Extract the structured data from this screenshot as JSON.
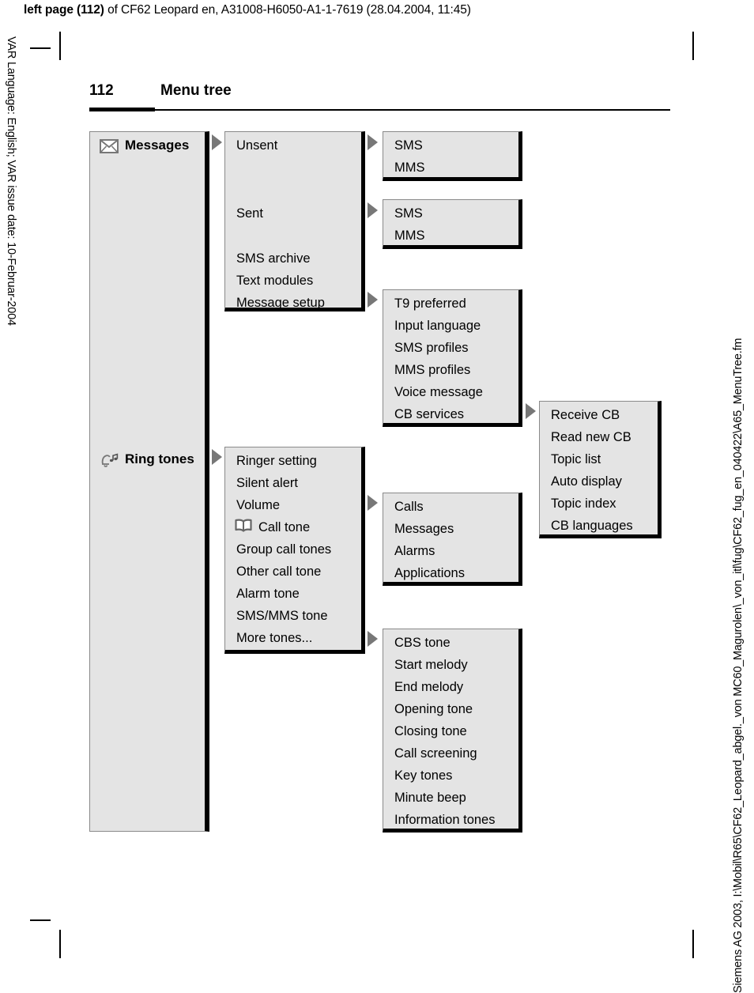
{
  "header": {
    "bold_prefix": "left page (112)",
    "rest": " of CF62 Leopard en, A31008-H6050-A1-1-7619 (28.04.2004, 11:45)"
  },
  "side_text": {
    "left": "VAR Language: English; VAR issue date: 10-Februar-2004",
    "right": "Siemens AG 2003, I:\\Mobil\\R65\\CF62_Leopard_abgel._von MC60_Magurolen\\_von_itl\\fug\\CF62_fug_en_040422\\A65_MenuTree.fm"
  },
  "running_head": {
    "page_number": "112",
    "title": "Menu tree"
  },
  "menu": {
    "messages": {
      "label": "Messages",
      "icon": "envelope-icon",
      "items": [
        {
          "label": "Unsent",
          "has_arrow": true
        },
        {
          "label": "Sent",
          "has_arrow": true
        },
        {
          "label": "SMS archive",
          "has_arrow": false
        },
        {
          "label": "Text modules",
          "has_arrow": false
        },
        {
          "label": "Message setup",
          "has_arrow": true
        }
      ],
      "unsent_sub": [
        "SMS",
        "MMS"
      ],
      "sent_sub": [
        "SMS",
        "MMS"
      ],
      "message_setup_sub": [
        {
          "label": "T9 preferred",
          "has_arrow": false
        },
        {
          "label": "Input language",
          "has_arrow": false
        },
        {
          "label": "SMS profiles",
          "has_arrow": false
        },
        {
          "label": "MMS profiles",
          "has_arrow": false
        },
        {
          "label": "Voice message",
          "has_arrow": false
        },
        {
          "label": "CB services",
          "has_arrow": true
        }
      ],
      "cb_services_sub": [
        "Receive CB",
        "Read new CB",
        "Topic list",
        "Auto display",
        "Topic index",
        "CB languages"
      ]
    },
    "ring_tones": {
      "label": "Ring tones",
      "icon": "bell-note-icon",
      "items": [
        {
          "label": "Ringer setting",
          "has_arrow": false,
          "icon": null
        },
        {
          "label": "Silent alert",
          "has_arrow": false,
          "icon": null
        },
        {
          "label": "Volume",
          "has_arrow": true,
          "icon": null
        },
        {
          "label": "Call tone",
          "has_arrow": false,
          "icon": "open-book-icon"
        },
        {
          "label": "Group call tones",
          "has_arrow": false,
          "icon": null
        },
        {
          "label": "Other call tone",
          "has_arrow": false,
          "icon": null
        },
        {
          "label": "Alarm tone",
          "has_arrow": false,
          "icon": null
        },
        {
          "label": "SMS/MMS tone",
          "has_arrow": false,
          "icon": null
        },
        {
          "label": "More tones...",
          "has_arrow": true,
          "icon": null
        }
      ],
      "volume_sub": [
        "Calls",
        "Messages",
        "Alarms",
        "Applications"
      ],
      "more_tones_sub": [
        "CBS tone",
        "Start melody",
        "End melody",
        "Opening tone",
        "Closing tone",
        "Call screening",
        "Key tones",
        "Minute beep",
        "Information tones"
      ]
    }
  }
}
